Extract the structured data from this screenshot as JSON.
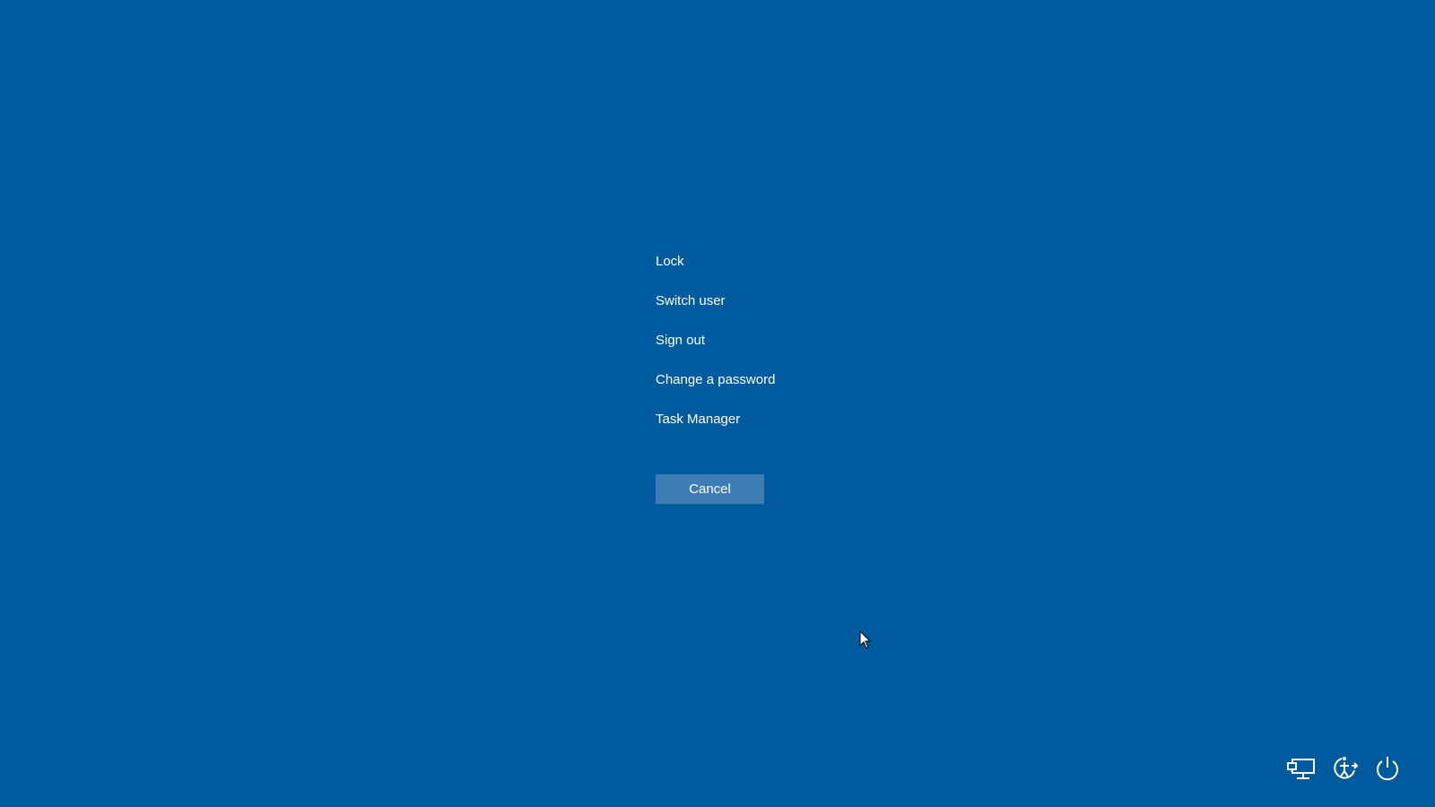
{
  "menu": {
    "items": [
      {
        "label": "Lock"
      },
      {
        "label": "Switch user"
      },
      {
        "label": "Sign out"
      },
      {
        "label": "Change a password"
      },
      {
        "label": "Task Manager"
      }
    ]
  },
  "cancel": {
    "label": "Cancel"
  },
  "tray": {
    "icons": [
      {
        "name": "network-icon"
      },
      {
        "name": "ease-of-access-icon"
      },
      {
        "name": "power-icon"
      }
    ]
  },
  "colors": {
    "background": "#005a9e",
    "button": "#3f7cb3",
    "text": "#ffffff"
  }
}
